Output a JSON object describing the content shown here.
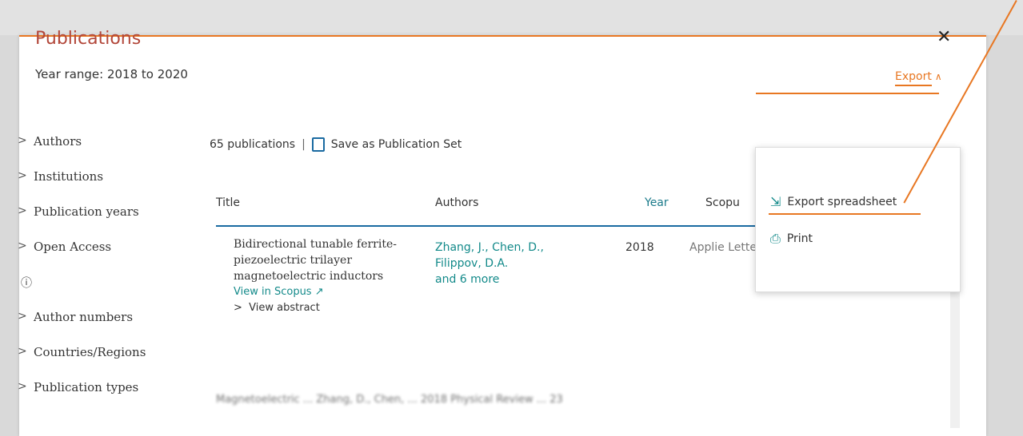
{
  "modal": {
    "title": "Publications",
    "year_range": "Year range: 2018 to 2020",
    "close_glyph": "✕",
    "export_label": "Export",
    "export_chevron": "∧"
  },
  "sidebar": {
    "items": [
      {
        "label": "Authors"
      },
      {
        "label": "Institutions"
      },
      {
        "label": "Publication years"
      },
      {
        "label": "Open Access"
      },
      {
        "label": "Author numbers"
      },
      {
        "label": "Countries/Regions"
      },
      {
        "label": "Publication types"
      }
    ],
    "info_glyph": "ⓘ"
  },
  "toolbar": {
    "count": "65 publications",
    "separator": "|",
    "save_label": "Save as Publication Set"
  },
  "table": {
    "headers": {
      "title": "Title",
      "authors": "Authors",
      "year": "Year",
      "scopus": "Scopu"
    },
    "rows": [
      {
        "title": "Bidirectional tunable ferrite-piezoelectric trilayer magnetoelectric inductors",
        "view_in_scopus": "View in Scopus ↗",
        "view_abstract": "View abstract",
        "authors": "Zhang, J., Chen, D., Filippov, D.A.",
        "more": "and 6 more",
        "year": "2018",
        "journal": "Applie Letters"
      }
    ],
    "row2_preview": "Magnetoelectric ...   Zhang, D., Chen, ...   2018   Physical Review ...   23"
  },
  "export_menu": {
    "spreadsheet_label": "Export spreadsheet",
    "print_label": "Print"
  },
  "colors": {
    "accent": "#e87722",
    "title": "#b2473a",
    "link": "#138a8a",
    "divider": "#1a6aa1"
  }
}
